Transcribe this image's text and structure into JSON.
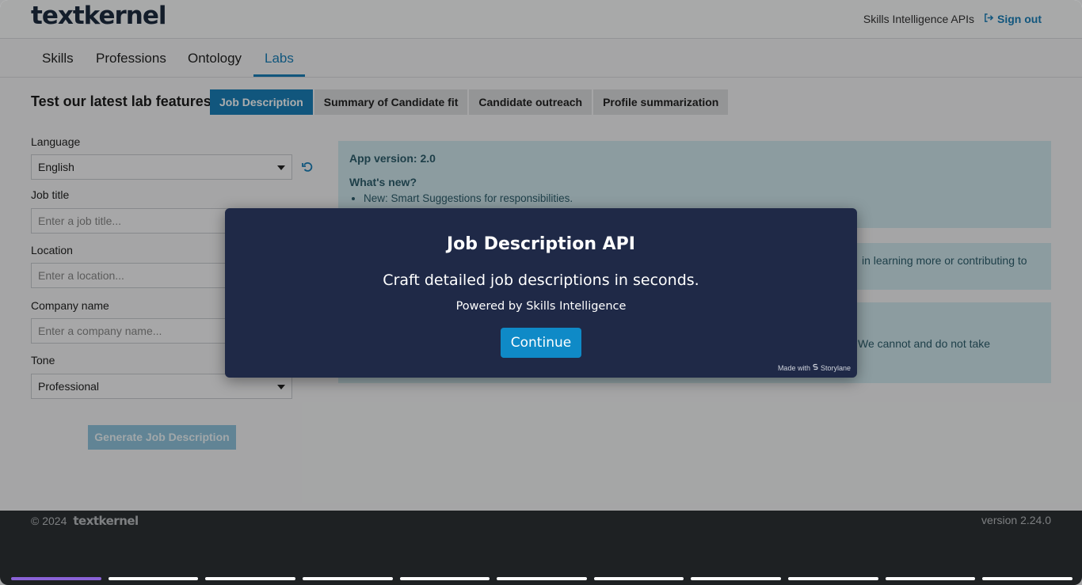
{
  "header": {
    "logo_text": "textkernel",
    "product_label": "Skills Intelligence APIs",
    "signout_label": "Sign out"
  },
  "nav": {
    "tabs": [
      {
        "label": "Skills",
        "active": false
      },
      {
        "label": "Professions",
        "active": false
      },
      {
        "label": "Ontology",
        "active": false
      },
      {
        "label": "Labs",
        "active": true
      }
    ]
  },
  "labs": {
    "title": "Test our latest lab features",
    "tabs": [
      {
        "label": "Job Description",
        "active": true
      },
      {
        "label": "Summary of Candidate fit",
        "active": false
      },
      {
        "label": "Candidate outreach",
        "active": false
      },
      {
        "label": "Profile summarization",
        "active": false
      }
    ]
  },
  "form": {
    "language_label": "Language",
    "language_value": "English",
    "job_title_label": "Job title",
    "job_title_placeholder": "Enter a job title...",
    "location_label": "Location",
    "location_placeholder": "Enter a location...",
    "company_label": "Company name",
    "company_placeholder": "Enter a company name...",
    "tone_label": "Tone",
    "tone_value": "Professional",
    "generate_label": "Generate Job Description"
  },
  "info": {
    "version": "App version: 2.0",
    "whats_new": "What's new?",
    "items": [
      "New: Smart Suggestions for responsibilities."
    ],
    "box2_text": "in learning more or contributing to",
    "box3_text": "We cannot and do not take"
  },
  "modal": {
    "title": "Job Description API",
    "subtitle": "Craft detailed job descriptions in seconds.",
    "powered": "Powered by Skills Intelligence",
    "continue_label": "Continue",
    "made_with": "Made with",
    "made_brand": "Storylane"
  },
  "footer": {
    "copyright": "© 2024",
    "logo_text": "textkernel",
    "version": "version 2.24.0"
  },
  "progress": {
    "total_steps": 11,
    "current_step": 1,
    "accent_color": "#8a62d6"
  }
}
